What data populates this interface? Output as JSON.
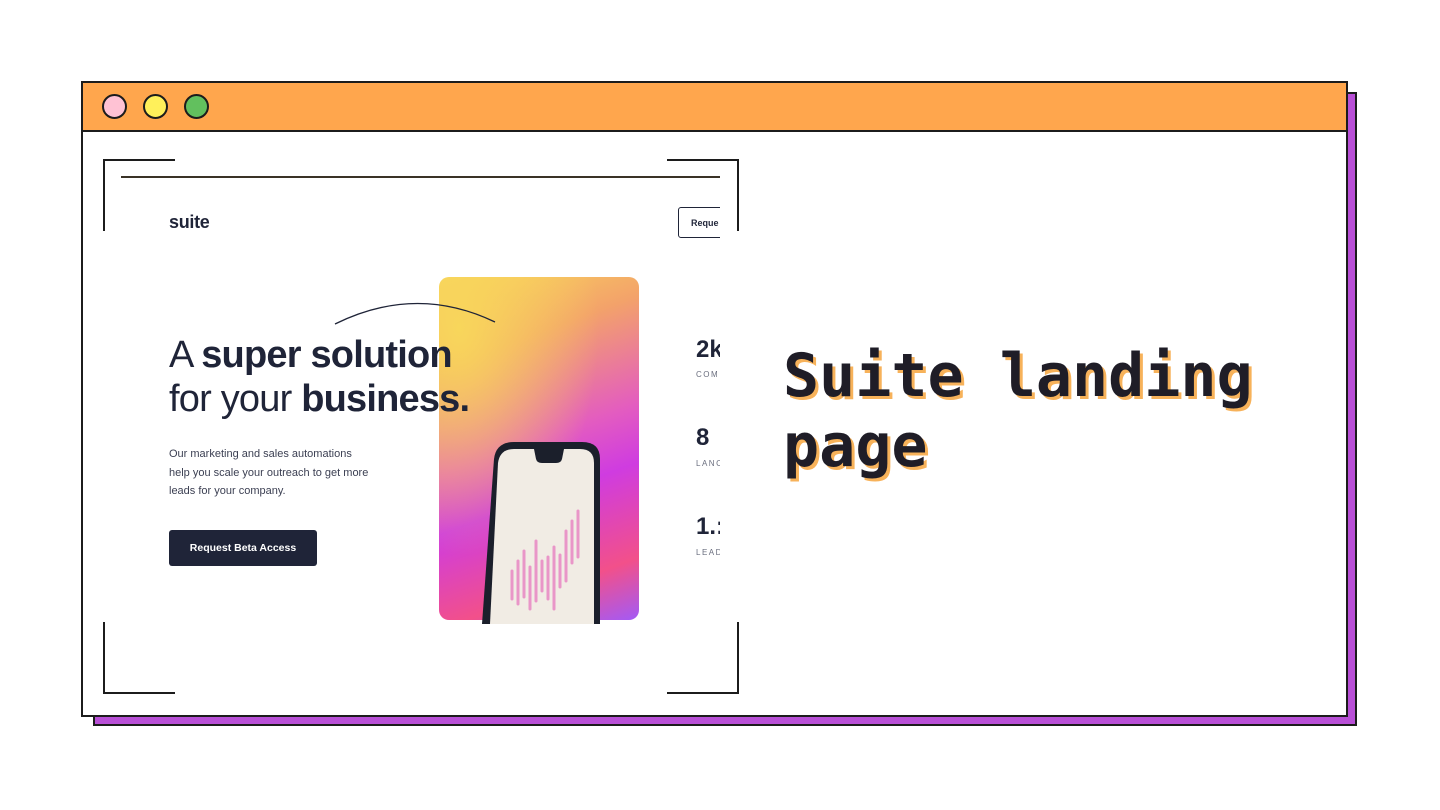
{
  "window": {
    "controls": [
      "close-dot",
      "minimize-dot",
      "maximize-dot"
    ],
    "colors": {
      "titlebar": "#ffa64d",
      "shadow": "#b84fd6",
      "dot_close": "#ffc2d4",
      "dot_minimize": "#fff05a",
      "dot_maximize": "#62c05e"
    }
  },
  "preview": {
    "logo": "suite",
    "nav_button": "Reque",
    "headline_light_1": "A ",
    "headline_bold_1": "super solution",
    "headline_light_2": "for your ",
    "headline_bold_2": "business.",
    "description": "Our marketing and sales automations help you scale your outreach to get more leads for your company.",
    "cta_label": "Request Beta Access",
    "stats": [
      {
        "value": "2k",
        "label": "COM"
      },
      {
        "value": "8",
        "label": "LANC"
      },
      {
        "value": "1.:",
        "label": "LEAD"
      }
    ]
  },
  "title": "Suite landing page"
}
